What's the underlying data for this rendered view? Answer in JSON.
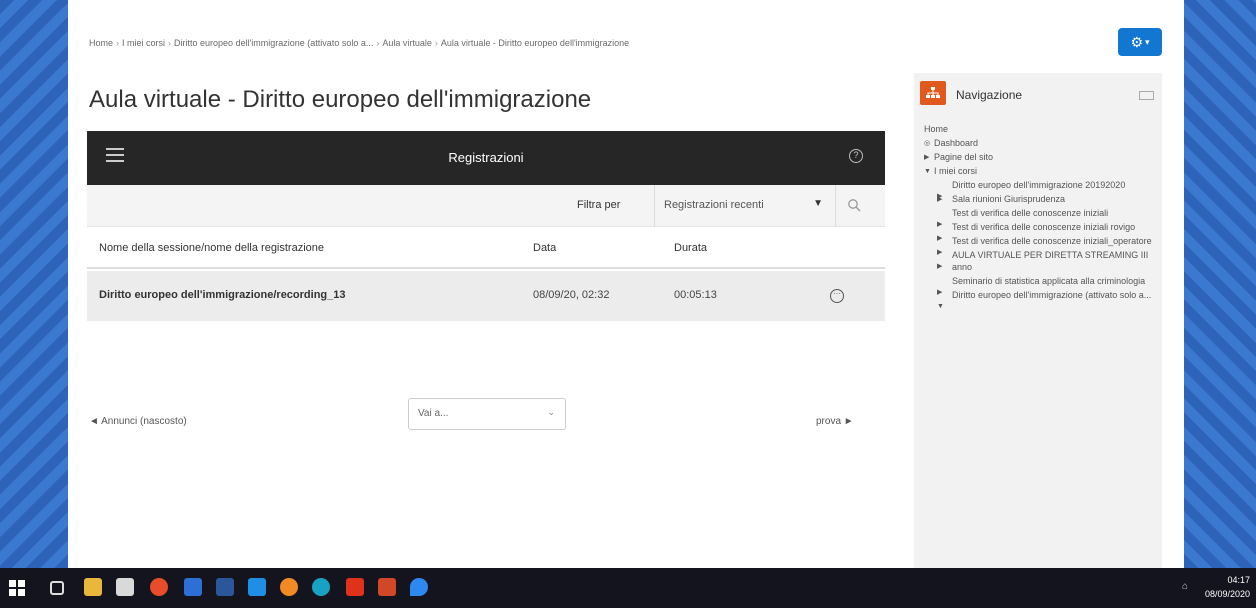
{
  "breadcrumb": {
    "items": [
      "Home",
      "I miei corsi",
      "Diritto europeo dell'immigrazione (attivato solo a...",
      "Aula virtuale",
      "Aula virtuale - Diritto europeo dell'immigrazione"
    ]
  },
  "page_title": "Aula virtuale - Diritto europeo dell'immigrazione",
  "recordings": {
    "header_title": "Registrazioni",
    "filter_label": "Filtra per",
    "filter_value": "Registrazioni recenti",
    "columns": {
      "name": "Nome della sessione/nome della registrazione",
      "date": "Data",
      "duration": "Durata"
    },
    "rows": [
      {
        "name": "Diritto europeo dell'immigrazione/recording_13",
        "date": "08/09/20, 02:32",
        "duration": "00:05:13"
      }
    ]
  },
  "activity_nav": {
    "prev": "◄ Annunci (nascosto)",
    "jump_placeholder": "Vai a...",
    "next": "prova ►"
  },
  "nav_block": {
    "title": "Navigazione",
    "items": [
      {
        "level": 1,
        "label": "Home"
      },
      {
        "level": 2,
        "label": "Dashboard"
      },
      {
        "level": 2,
        "label": "Pagine del sito",
        "arrow": "▶"
      },
      {
        "level": 2,
        "label": "I miei corsi",
        "arrow": "▼"
      },
      {
        "level": 3,
        "label": "Diritto europeo dell'immigrazione 20192020",
        "arrow": "▶"
      },
      {
        "level": 3,
        "label": "Sala riunioni Giurisprudenza",
        "arrow": "▶"
      },
      {
        "level": 3,
        "label": "Test di verifica delle conoscenze iniziali",
        "arrow": "▶"
      },
      {
        "level": 3,
        "label": "Test di verifica delle conoscenze iniziali rovigo",
        "arrow": "▶"
      },
      {
        "level": 3,
        "label": "Test di verifica delle conoscenze iniziali_operatore",
        "arrow": "▶"
      },
      {
        "level": 3,
        "label": "AULA VIRTUALE PER DIRETTA STREAMING III anno",
        "arrow": "▶"
      },
      {
        "level": 3,
        "label": "Seminario di statistica applicata alla criminologia",
        "arrow": "▶"
      },
      {
        "level": 3,
        "label": "Diritto europeo dell'immigrazione (attivato solo a...",
        "arrow": "▼"
      }
    ]
  },
  "taskbar": {
    "time": "04:17",
    "date": "08/09/2020"
  },
  "colors": {
    "header_dark": "#262626",
    "accent_blue": "#1177d1",
    "nav_orange": "#e05a1e"
  }
}
